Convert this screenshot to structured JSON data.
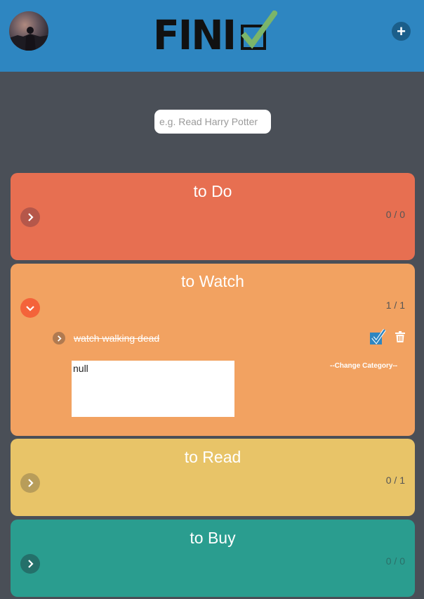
{
  "header": {
    "logo_text": "FINI",
    "add_label": "+"
  },
  "search": {
    "placeholder": "e.g. Read Harry Potter",
    "value": ""
  },
  "categories": [
    {
      "title": "to Do",
      "count": "0 / 0",
      "color": "#e76f51",
      "expanded": false
    },
    {
      "title": "to Watch",
      "count": "1 / 1",
      "color": "#f2a261",
      "expanded": true,
      "items": [
        {
          "text": "watch walking dead",
          "done": true,
          "notes": "null",
          "change_category_label": "--Change Category--"
        }
      ]
    },
    {
      "title": "to Read",
      "count": "0 / 1",
      "color": "#e8c468",
      "expanded": false
    },
    {
      "title": "to Buy",
      "count": "0 / 0",
      "color": "#2a9d8f",
      "expanded": false
    }
  ],
  "colors": {
    "header": "#2e86c1",
    "background": "#4a4f57",
    "add_button": "#1b5e8a",
    "expanded_toggle": "#f4633a",
    "check_blue": "#2e86c1"
  },
  "icons": {
    "avatar": "user-avatar",
    "logo_check": "checkbox-check-icon",
    "add": "plus-icon",
    "toggle_collapsed": "chevron-right-icon",
    "toggle_expanded": "chevron-down-icon",
    "done": "checked-box-icon",
    "delete": "trash-icon"
  }
}
